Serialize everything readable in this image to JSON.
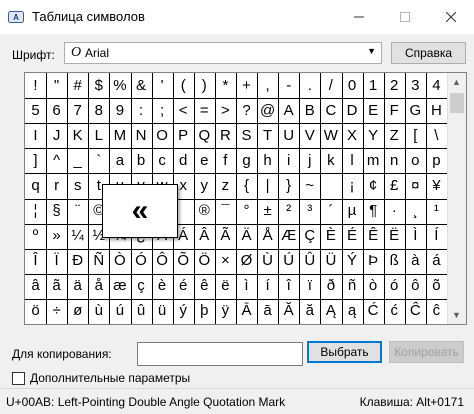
{
  "window": {
    "title": "Таблица символов"
  },
  "font": {
    "label": "Шрифт:",
    "selected": "Arial",
    "help_button": "Справка"
  },
  "grid": {
    "columns": 20,
    "rows": [
      [
        "!",
        "\"",
        "#",
        "$",
        "%",
        "&",
        "'",
        "(",
        ")",
        "*",
        "+",
        ",",
        "-",
        ".",
        "/",
        "0",
        "1",
        "2",
        "3",
        "4"
      ],
      [
        "5",
        "6",
        "7",
        "8",
        "9",
        ":",
        ";",
        "<",
        "=",
        ">",
        "?",
        "@",
        "A",
        "B",
        "C",
        "D",
        "E",
        "F",
        "G",
        "H"
      ],
      [
        "I",
        "J",
        "K",
        "L",
        "M",
        "N",
        "O",
        "P",
        "Q",
        "R",
        "S",
        "T",
        "U",
        "V",
        "W",
        "X",
        "Y",
        "Z",
        "[",
        "\\"
      ],
      [
        "]",
        "^",
        "_",
        "`",
        "a",
        "b",
        "c",
        "d",
        "e",
        "f",
        "g",
        "h",
        "i",
        "j",
        "k",
        "l",
        "m",
        "n",
        "o",
        "p"
      ],
      [
        "q",
        "r",
        "s",
        "t",
        "u",
        "v",
        "w",
        "x",
        "y",
        "z",
        "{",
        "|",
        "}",
        "~",
        " ",
        "¡",
        "¢",
        "£",
        "¤",
        "¥"
      ],
      [
        "¦",
        "§",
        "¨",
        "©",
        "ª",
        "«",
        "¬",
        "­",
        "®",
        "¯",
        "°",
        "±",
        "²",
        "³",
        "´",
        "µ",
        "¶",
        "·",
        "¸",
        "¹"
      ],
      [
        "º",
        "»",
        "¼",
        "½",
        "¾",
        "¿",
        "À",
        "Á",
        "Â",
        "Ã",
        "Ä",
        "Å",
        "Æ",
        "Ç",
        "È",
        "É",
        "Ê",
        "Ë",
        "Ì",
        "Í"
      ],
      [
        "Î",
        "Ï",
        "Ð",
        "Ñ",
        "Ò",
        "Ó",
        "Ô",
        "Õ",
        "Ö",
        "×",
        "Ø",
        "Ù",
        "Ú",
        "Û",
        "Ü",
        "Ý",
        "Þ",
        "ß",
        "à",
        "á"
      ],
      [
        "â",
        "ã",
        "ä",
        "å",
        "æ",
        "ç",
        "è",
        "é",
        "ê",
        "ë",
        "ì",
        "í",
        "î",
        "ï",
        "ð",
        "ñ",
        "ò",
        "ó",
        "ô",
        "õ"
      ],
      [
        "ö",
        "÷",
        "ø",
        "ù",
        "ú",
        "û",
        "ü",
        "ý",
        "þ",
        "ÿ",
        "Ā",
        "ā",
        "Ă",
        "ă",
        "Ą",
        "ą",
        "Ć",
        "ć",
        "Ĉ",
        "ĉ"
      ]
    ],
    "selected_char": "«"
  },
  "copy": {
    "label": "Для копирования:",
    "value": "",
    "select_button": "Выбрать",
    "copy_button": "Копировать"
  },
  "advanced": {
    "label": "Дополнительные параметры",
    "checked": false
  },
  "status": {
    "left": "U+00AB: Left-Pointing Double Angle Quotation Mark",
    "right": "Клавиша: Alt+0171"
  }
}
